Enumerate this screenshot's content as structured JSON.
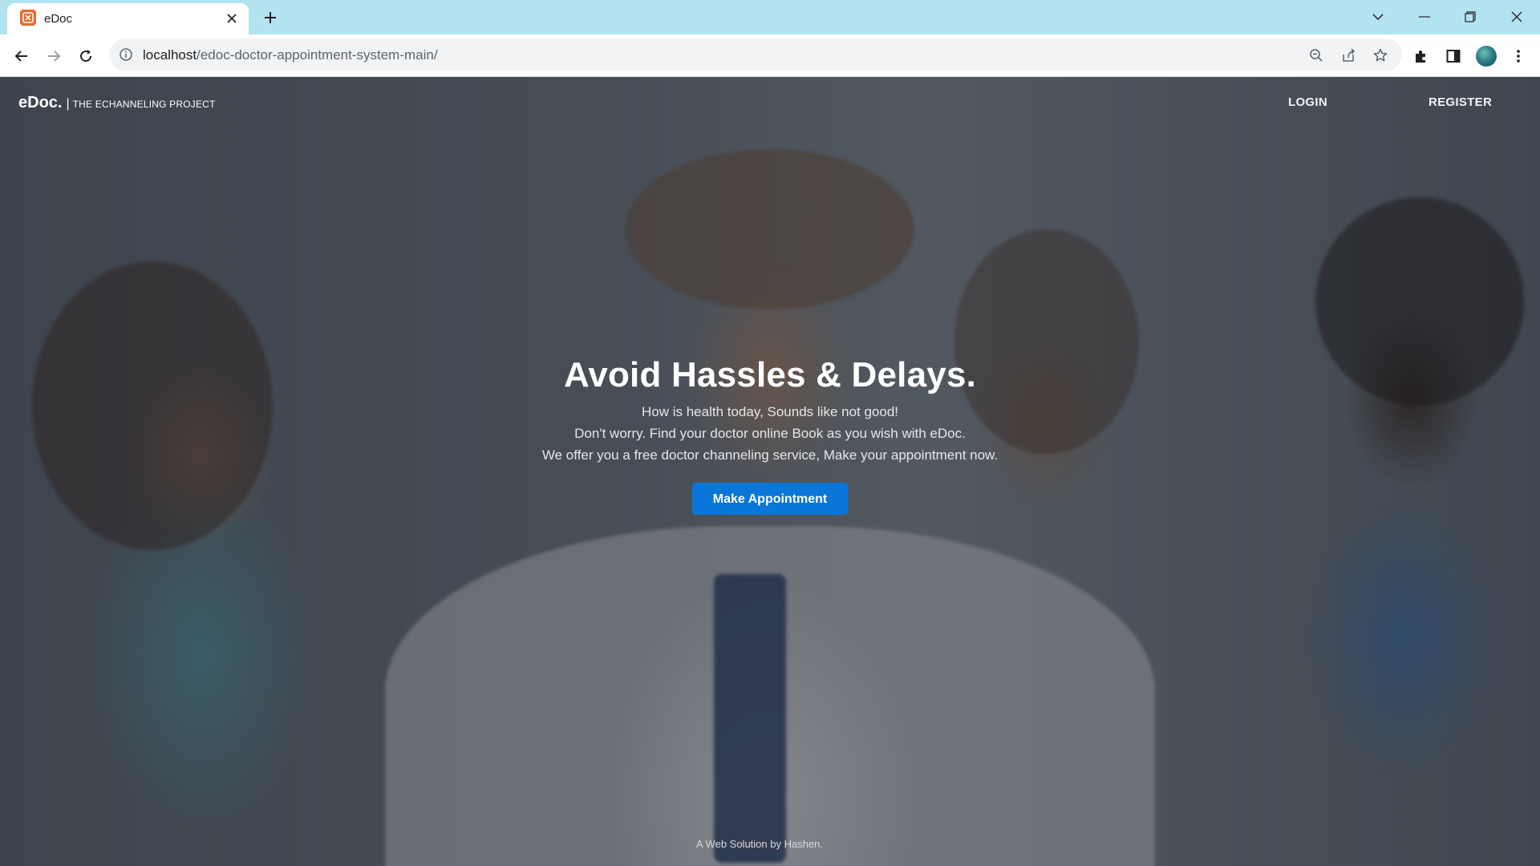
{
  "browser": {
    "tab_title": "eDoc",
    "url_host": "localhost",
    "url_path": "/edoc-doctor-appointment-system-main/",
    "icons": [
      "back-icon",
      "forward-icon",
      "reload-icon",
      "site-info-icon",
      "zoom-icon",
      "share-icon",
      "star-icon",
      "extensions-icon",
      "side-panel-icon",
      "profile-avatar",
      "menu-icon"
    ]
  },
  "site": {
    "logo": "eDoc.",
    "separator": "|",
    "tagline": "THE ECHANNELING PROJECT",
    "nav": {
      "login": "LOGIN",
      "register": "REGISTER"
    },
    "hero": {
      "title": "Avoid Hassles & Delays.",
      "line1": "How is health today, Sounds like not good!",
      "line2": "Don't worry. Find your doctor online Book as you wish with eDoc.",
      "line3": "We offer you a free doctor channeling service, Make your appointment now.",
      "button": "Make Appointment"
    },
    "footer": "A Web Solution by Hashen.",
    "accent_color": "#0a76d8"
  }
}
